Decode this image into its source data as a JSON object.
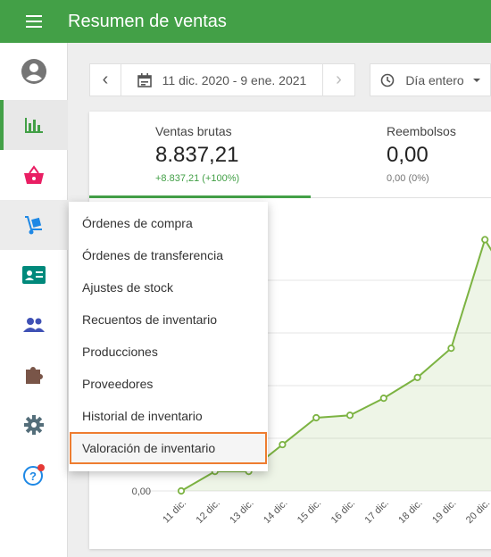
{
  "app": {
    "title": "Resumen de ventas"
  },
  "sidebar": {
    "items": [
      {
        "name": "account",
        "icon": "account-circle-icon"
      },
      {
        "name": "reports",
        "icon": "bar-chart-icon",
        "active": true
      },
      {
        "name": "items",
        "icon": "basket-icon"
      },
      {
        "name": "inventory",
        "icon": "hand-truck-icon"
      },
      {
        "name": "employees",
        "icon": "id-card-icon"
      },
      {
        "name": "customers",
        "icon": "people-icon"
      },
      {
        "name": "integrations",
        "icon": "puzzle-icon"
      },
      {
        "name": "settings",
        "icon": "gear-icon"
      },
      {
        "name": "help",
        "icon": "help-icon"
      }
    ]
  },
  "toolbar": {
    "prev": "‹",
    "date_range": "11 dic. 2020 - 9 ene. 2021",
    "next": "›",
    "time_filter": "Día entero"
  },
  "metrics": [
    {
      "label": "Ventas brutas",
      "value": "8.837,21",
      "change": "+8.837,21 (+100%)"
    },
    {
      "label": "Reembolsos",
      "value": "0,00",
      "change": "0,00 (0%)"
    }
  ],
  "dropdown": {
    "items": [
      "Órdenes de compra",
      "Órdenes de transferencia",
      "Ajustes de stock",
      "Recuentos de inventario",
      "Producciones",
      "Proveedores",
      "Historial de inventario",
      "Valoración de inventario"
    ],
    "highlighted": "Valoración de inventario"
  },
  "colors": {
    "accent": "#43a047",
    "highlight": "#ee7d30",
    "line": "#7cb342"
  },
  "chart_data": {
    "type": "area",
    "y_tick_labels": [
      "0,00"
    ],
    "categories": [
      "11 dic.",
      "12 dic.",
      "13 dic.",
      "14 dic.",
      "15 dic.",
      "16 dic.",
      "17 dic.",
      "18 dic.",
      "19 dic.",
      "20 dic."
    ],
    "values": [
      0,
      160,
      160,
      380,
      600,
      620,
      760,
      930,
      1170,
      2060
    ],
    "ylim": [
      0,
      2400
    ]
  }
}
